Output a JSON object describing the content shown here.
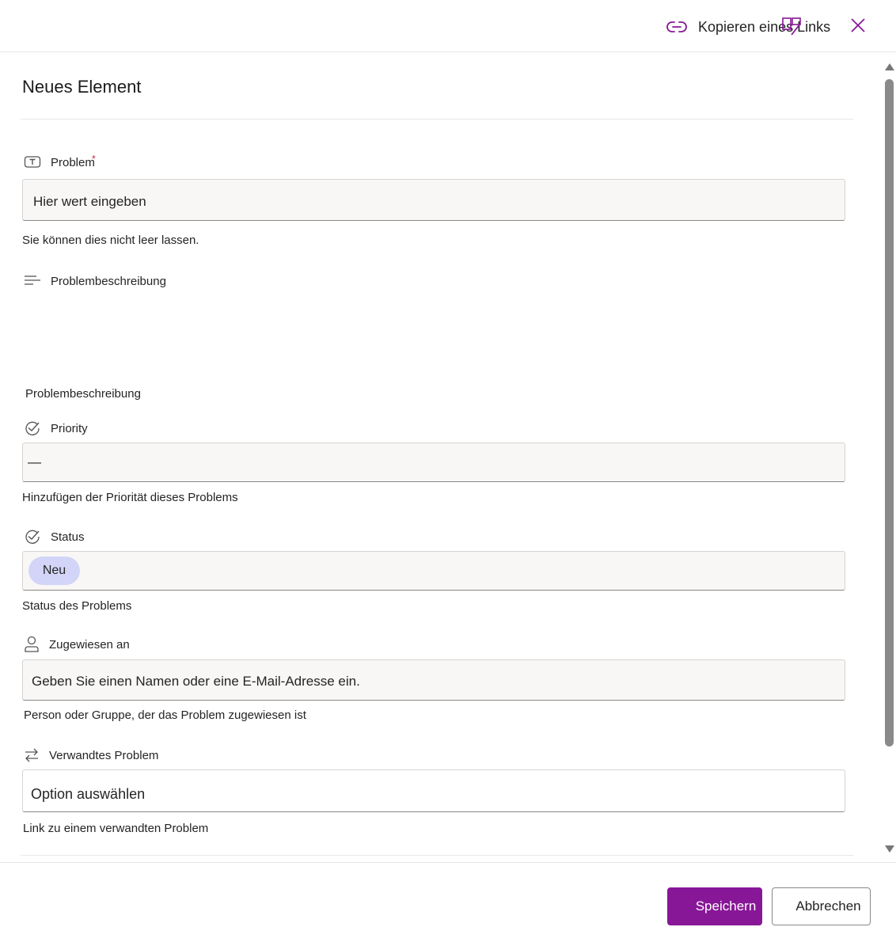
{
  "header": {
    "copy_link_label": "Kopieren eines Links",
    "copy_link_icon": "link-icon",
    "edit_icon": "edit-form-icon",
    "close_icon": "close-icon"
  },
  "form": {
    "title": "Neues Element",
    "fields": {
      "problem": {
        "label": "Problem",
        "required_mark": "*",
        "icon": "text-field-icon",
        "placeholder": "Hier wert eingeben",
        "helper": "Sie können dies nicht leer lassen."
      },
      "description": {
        "label": "Problembeschreibung",
        "icon": "multiline-text-icon",
        "helper": "Problembeschreibung"
      },
      "priority": {
        "label": "Priority",
        "icon": "choice-check-icon",
        "value": "—",
        "helper": "Hinzufügen der Priorität dieses Problems"
      },
      "status": {
        "label": "Status",
        "icon": "choice-check-icon",
        "value": "Neu",
        "helper": "Status des Problems"
      },
      "assigned_to": {
        "label": "Zugewiesen an",
        "icon": "person-icon",
        "placeholder": "Geben Sie einen Namen oder eine E-Mail-Adresse ein.",
        "helper": "Person oder Gruppe, der das Problem zugewiesen ist"
      },
      "related": {
        "label": "Verwandtes Problem",
        "icon": "lookup-arrows-icon",
        "placeholder": "Option auswählen",
        "helper": "Link zu einem verwandten Problem"
      }
    }
  },
  "footer": {
    "save_label": "Speichern",
    "cancel_label": "Abbrechen"
  },
  "colors": {
    "accent": "#881798",
    "status_pill": "#d2d5f7",
    "input_bg": "#f8f7f6"
  }
}
